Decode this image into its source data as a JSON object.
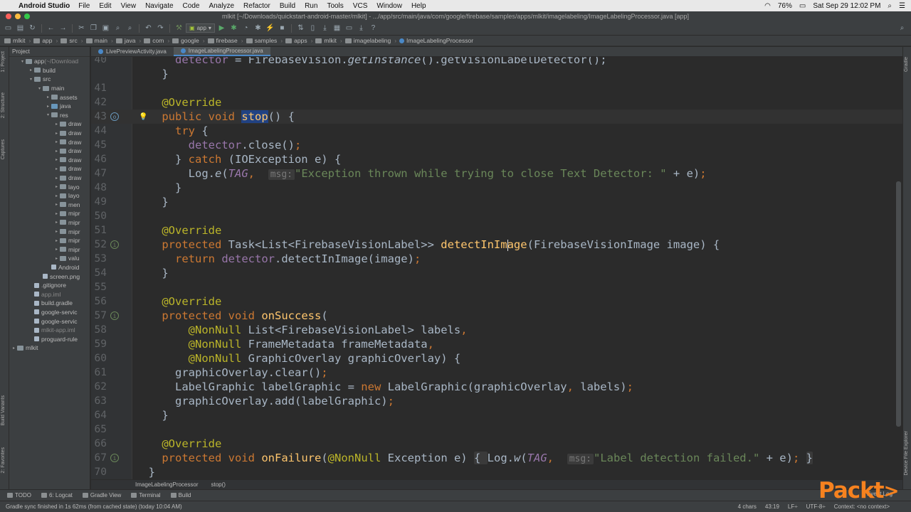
{
  "menubar": {
    "app_name": "Android Studio",
    "items": [
      "File",
      "Edit",
      "View",
      "Navigate",
      "Code",
      "Analyze",
      "Refactor",
      "Build",
      "Run",
      "Tools",
      "VCS",
      "Window",
      "Help"
    ],
    "battery": "76%",
    "datetime": "Sat Sep 29  12:02 PM"
  },
  "window": {
    "title": "mlkit [~/Downloads/quickstart-android-master/mlkit] - .../app/src/main/java/com/google/firebase/samples/apps/mlkit/imagelabeling/ImageLabelingProcessor.java [app]"
  },
  "toolbar": {
    "run_config": "app"
  },
  "breadcrumb": [
    "mlkit",
    "app",
    "src",
    "main",
    "java",
    "com",
    "google",
    "firebase",
    "samples",
    "apps",
    "mlkit",
    "imagelabeling",
    "ImageLabelingProcessor"
  ],
  "left_strip": {
    "tabs": [
      "1: Project",
      "2: Structure",
      "Captures",
      "Build Variants",
      "2: Favorites"
    ]
  },
  "right_strip": {
    "tabs": [
      "Gradle",
      "Device File Explorer"
    ]
  },
  "project": {
    "header": "Project",
    "tree": [
      {
        "depth": 0,
        "arrow": "▾",
        "icon": "folder",
        "label": "app",
        "suffix": " (~/Download"
      },
      {
        "depth": 1,
        "arrow": "▸",
        "icon": "folder",
        "label": "build"
      },
      {
        "depth": 1,
        "arrow": "▾",
        "icon": "folder",
        "label": "src"
      },
      {
        "depth": 2,
        "arrow": "▾",
        "icon": "folder",
        "label": "main"
      },
      {
        "depth": 3,
        "arrow": "▸",
        "icon": "folder",
        "label": "assets"
      },
      {
        "depth": 3,
        "arrow": "▸",
        "icon": "src",
        "label": "java"
      },
      {
        "depth": 3,
        "arrow": "▾",
        "icon": "folder",
        "label": "res"
      },
      {
        "depth": 4,
        "arrow": "▸",
        "icon": "folder",
        "label": "draw"
      },
      {
        "depth": 4,
        "arrow": "▸",
        "icon": "folder",
        "label": "draw"
      },
      {
        "depth": 4,
        "arrow": "▸",
        "icon": "folder",
        "label": "draw"
      },
      {
        "depth": 4,
        "arrow": "▸",
        "icon": "folder",
        "label": "draw"
      },
      {
        "depth": 4,
        "arrow": "▸",
        "icon": "folder",
        "label": "draw"
      },
      {
        "depth": 4,
        "arrow": "▸",
        "icon": "folder",
        "label": "draw"
      },
      {
        "depth": 4,
        "arrow": "▸",
        "icon": "folder",
        "label": "draw"
      },
      {
        "depth": 4,
        "arrow": "▸",
        "icon": "folder",
        "label": "layo"
      },
      {
        "depth": 4,
        "arrow": "▸",
        "icon": "folder",
        "label": "layo"
      },
      {
        "depth": 4,
        "arrow": "▸",
        "icon": "folder",
        "label": "men"
      },
      {
        "depth": 4,
        "arrow": "▸",
        "icon": "folder",
        "label": "mipr"
      },
      {
        "depth": 4,
        "arrow": "▸",
        "icon": "folder",
        "label": "mipr"
      },
      {
        "depth": 4,
        "arrow": "▸",
        "icon": "folder",
        "label": "mipr"
      },
      {
        "depth": 4,
        "arrow": "▸",
        "icon": "folder",
        "label": "mipr"
      },
      {
        "depth": 4,
        "arrow": "▸",
        "icon": "folder",
        "label": "mipr"
      },
      {
        "depth": 4,
        "arrow": "▸",
        "icon": "folder",
        "label": "valu"
      },
      {
        "depth": 3,
        "arrow": "",
        "icon": "file",
        "label": "Android"
      },
      {
        "depth": 2,
        "arrow": "",
        "icon": "file",
        "label": "screen.png"
      },
      {
        "depth": 1,
        "arrow": "",
        "icon": "file",
        "label": ".gitignore"
      },
      {
        "depth": 1,
        "arrow": "",
        "icon": "file",
        "label": "app.iml",
        "muted": true
      },
      {
        "depth": 1,
        "arrow": "",
        "icon": "file",
        "label": "build.gradle"
      },
      {
        "depth": 1,
        "arrow": "",
        "icon": "file",
        "label": "google-servic"
      },
      {
        "depth": 1,
        "arrow": "",
        "icon": "file",
        "label": "google-servic"
      },
      {
        "depth": 1,
        "arrow": "",
        "icon": "file",
        "label": "mlkit-app.iml",
        "muted": true
      },
      {
        "depth": 1,
        "arrow": "",
        "icon": "file",
        "label": "proguard-rule"
      },
      {
        "depth": -1,
        "arrow": "▸",
        "icon": "folder",
        "label": "mlkit"
      }
    ]
  },
  "tabs": [
    {
      "label": "LivePreviewActivity.java",
      "active": false
    },
    {
      "label": "ImageLabelingProcessor.java",
      "active": true
    }
  ],
  "editor": {
    "lines": [
      {
        "n": "40",
        "html": "      <span class=\"fld\">detector</span> = FirebaseVision.<span class=\"ital\">getInstance</span>().getVisionLabelDetector();"
      },
      {
        "n": "",
        "html": "    }"
      },
      {
        "n": "41",
        "html": ""
      },
      {
        "n": "42",
        "html": "    <span class=\"ann\">@Override</span>"
      },
      {
        "n": "43",
        "html": "    <span class=\"kw\">public void</span> <span class=\"fn sel\">stop</span>() {",
        "marker": "override",
        "bulb": true,
        "caret": true
      },
      {
        "n": "44",
        "html": "      <span class=\"kw\">try</span> {"
      },
      {
        "n": "45",
        "html": "        <span class=\"fld\">detector</span>.close()<span class=\"kw\">;</span>"
      },
      {
        "n": "46",
        "html": "      } <span class=\"kw\">catch</span> (IOException e) {"
      },
      {
        "n": "47",
        "html": "        Log.<span class=\"ital\">e</span>(<span class=\"fld ital\">TAG</span><span class=\"kw\">,</span>  <span class=\"hint\">msg:</span><span class=\"str\">\"Exception thrown while trying to close Text Detector: \"</span> + e)<span class=\"kw\">;</span>"
      },
      {
        "n": "48",
        "html": "      }"
      },
      {
        "n": "49",
        "html": "    }"
      },
      {
        "n": "50",
        "html": ""
      },
      {
        "n": "51",
        "html": "    <span class=\"ann\">@Override</span>"
      },
      {
        "n": "52",
        "html": "    <span class=\"kw\">protected</span> Task&lt;List&lt;FirebaseVisionLabel&gt;&gt; <span class=\"fn\">detectInImage</span>(FirebaseVisionImage image) {",
        "marker": "implement"
      },
      {
        "n": "53",
        "html": "      <span class=\"kw\">return</span> <span class=\"fld\">detector</span>.detectInImage(image)<span class=\"kw\">;</span>"
      },
      {
        "n": "54",
        "html": "    }"
      },
      {
        "n": "55",
        "html": ""
      },
      {
        "n": "56",
        "html": "    <span class=\"ann\">@Override</span>"
      },
      {
        "n": "57",
        "html": "    <span class=\"kw\">protected void</span> <span class=\"fn\">onSuccess</span>(",
        "marker": "implement"
      },
      {
        "n": "58",
        "html": "        <span class=\"ann\">@NonNull</span> List&lt;FirebaseVisionLabel&gt; labels<span class=\"kw\">,</span>"
      },
      {
        "n": "59",
        "html": "        <span class=\"ann\">@NonNull</span> FrameMetadata frameMetadata<span class=\"kw\">,</span>"
      },
      {
        "n": "60",
        "html": "        <span class=\"ann\">@NonNull</span> GraphicOverlay graphicOverlay) {"
      },
      {
        "n": "61",
        "html": "      graphicOverlay.clear()<span class=\"kw\">;</span>"
      },
      {
        "n": "62",
        "html": "      LabelGraphic labelGraphic = <span class=\"kw\">new</span> LabelGraphic(graphicOverlay<span class=\"kw\">,</span> labels)<span class=\"kw\">;</span>"
      },
      {
        "n": "63",
        "html": "      graphicOverlay.add(labelGraphic)<span class=\"kw\">;</span>"
      },
      {
        "n": "64",
        "html": "    }"
      },
      {
        "n": "65",
        "html": ""
      },
      {
        "n": "66",
        "html": "    <span class=\"ann\">@Override</span>"
      },
      {
        "n": "67",
        "html": "    <span class=\"kw\">protected void</span> <span class=\"fn\">onFailure</span>(<span class=\"ann\">@NonNull</span> Exception e) <span class=\"foldblk\">{ </span>Log.<span class=\"ital\">w</span>(<span class=\"fld ital\">TAG</span><span class=\"kw\">,</span>  <span class=\"hint\">msg:</span><span class=\"str\">\"Label detection failed.\"</span> + e)<span class=\"kw\">;</span> <span class=\"foldblk\">}</span>",
        "marker": "implement"
      },
      {
        "n": "70",
        "html": "  }"
      }
    ]
  },
  "editor_breadcrumb": [
    "ImageLabelingProcessor",
    "stop()"
  ],
  "bottom_tools": [
    {
      "label": "TODO"
    },
    {
      "label": "6: Logcat"
    },
    {
      "label": "Gradle View"
    },
    {
      "label": "Terminal"
    },
    {
      "label": "Build"
    }
  ],
  "event_log": "Event Log",
  "status": {
    "message": "Gradle sync finished in 1s 62ms (from cached state) (today 10:04 AM)",
    "chars": "4 chars",
    "position": "43:19",
    "line_sep": "LF÷",
    "encoding": "UTF-8÷",
    "context": "Context: <no context>"
  },
  "brand": "Packt",
  "colors": {
    "keyword": "#cc7832",
    "annotation": "#bbb529",
    "field": "#9876aa",
    "method": "#ffc66d",
    "string": "#6a8759",
    "background": "#2b2b2b",
    "brand": "#f6821f"
  }
}
